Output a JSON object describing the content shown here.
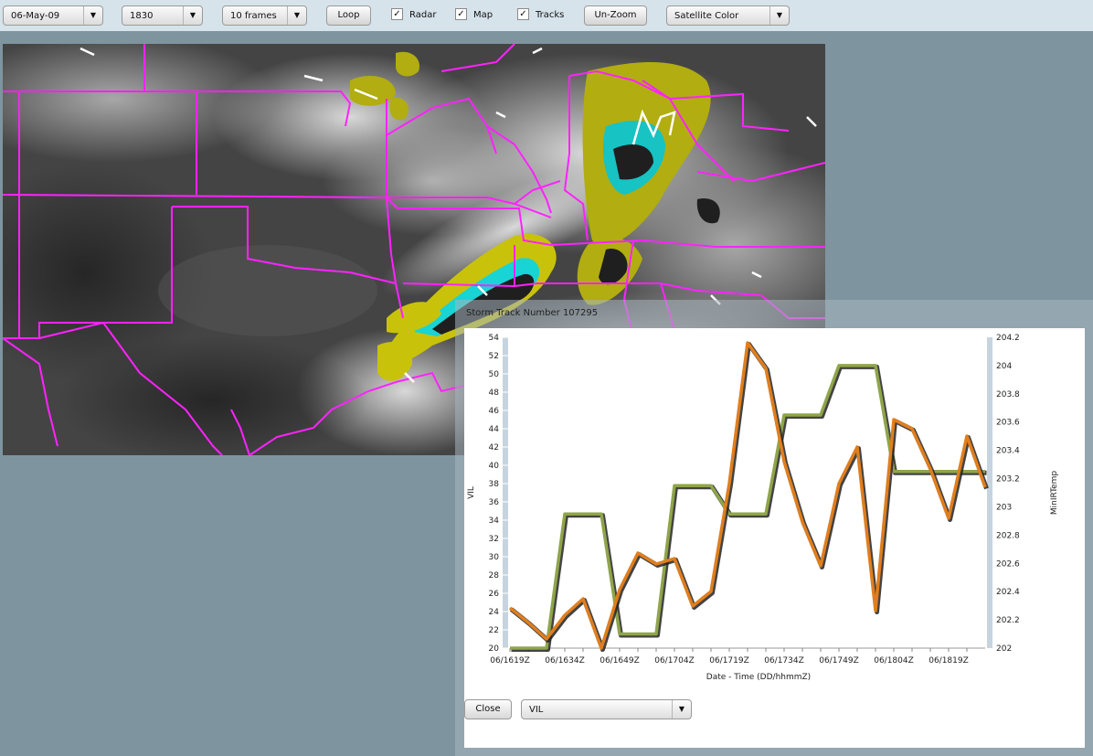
{
  "toolbar": {
    "date": "06-May-09",
    "time": "1830",
    "frames": "10 frames",
    "loop": "Loop",
    "radar": "Radar",
    "map": "Map",
    "tracks": "Tracks",
    "unzoom": "Un-Zoom",
    "imagery": "Satellite Color",
    "radar_checked": true,
    "map_checked": true,
    "tracks_checked": true
  },
  "storm_window": {
    "title": "Storm Track Number 107295",
    "close": "Close",
    "variable": "VIL"
  },
  "colors": {
    "vil": "#e07e1e",
    "minirtemp": "#8fa54a",
    "map_border": "#ff22ff"
  },
  "chart_data": {
    "type": "line",
    "xlabel": "Date - Time   (DD/hhmmZ)",
    "ylabel_left": "VIL",
    "ylabel_right": "MinIRTemp",
    "ylim": [
      20,
      54
    ],
    "y2lim": [
      202,
      204.2
    ],
    "yticks_left": [
      20,
      22,
      24,
      26,
      28,
      30,
      32,
      34,
      36,
      38,
      40,
      42,
      44,
      46,
      48,
      50,
      52,
      54
    ],
    "yticks_right": [
      "202",
      "202.2",
      "202.4",
      "202.6",
      "202.8",
      "203",
      "203.2",
      "203.4",
      "203.6",
      "203.8",
      "204",
      "204.2"
    ],
    "x": [
      "06/1619Z",
      "06/1624Z",
      "06/1629Z",
      "06/1634Z",
      "06/1639Z",
      "06/1644Z",
      "06/1649Z",
      "06/1654Z",
      "06/1659Z",
      "06/1704Z",
      "06/1709Z",
      "06/1714Z",
      "06/1719Z",
      "06/1724Z",
      "06/1729Z",
      "06/1734Z",
      "06/1739Z",
      "06/1744Z",
      "06/1749Z",
      "06/1754Z",
      "06/1759Z",
      "06/1804Z",
      "06/1809Z",
      "06/1814Z",
      "06/1819Z",
      "06/1824Z"
    ],
    "xticks": [
      "06/1619Z",
      "06/1634Z",
      "06/1649Z",
      "06/1704Z",
      "06/1719Z",
      "06/1734Z",
      "06/1749Z",
      "06/1804Z",
      "06/1819Z"
    ],
    "series": [
      {
        "name": "VIL",
        "axis": "left",
        "values": [
          24.4,
          22.8,
          21.0,
          23.6,
          25.4,
          20.0,
          26.4,
          30.4,
          29.2,
          29.8,
          24.6,
          26.2,
          38.0,
          53.4,
          50.6,
          40.4,
          33.8,
          29.0,
          38.0,
          42.0,
          24.1,
          45.0,
          44.0,
          39.6,
          34.2,
          43.2,
          37.6
        ]
      },
      {
        "name": "MinIRTemp",
        "axis": "right",
        "values": [
          202,
          202,
          202,
          202.95,
          202.95,
          202.95,
          202.1,
          202.1,
          202.1,
          203.15,
          203.15,
          203.15,
          202.95,
          202.95,
          202.95,
          203.65,
          203.65,
          203.65,
          204,
          204,
          204,
          203.25,
          203.25,
          203.25,
          203.25,
          203.25,
          203.25
        ]
      }
    ]
  }
}
